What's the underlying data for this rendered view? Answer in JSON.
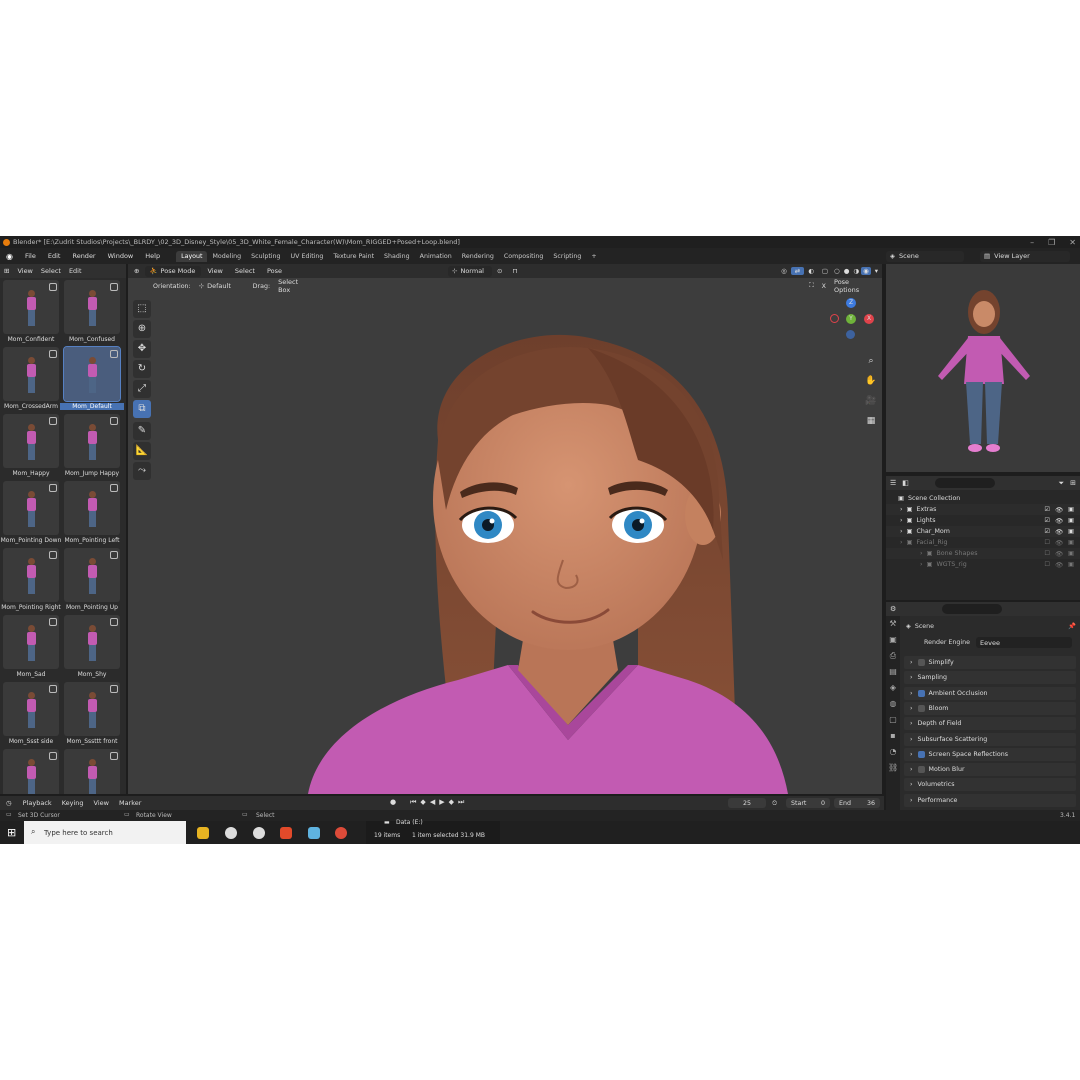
{
  "window": {
    "title": "Blender* [E:\\Zudrit Studios\\Projects\\_BLRDY_\\02_3D_Disney_Style\\05_3D_White_Female_Character(W)\\Mom_RIGGED+Posed+Loop.blend]"
  },
  "menu": [
    "File",
    "Edit",
    "Render",
    "Window",
    "Help"
  ],
  "workspace_tabs": [
    "Layout",
    "Modeling",
    "Sculpting",
    "UV Editing",
    "Texture Paint",
    "Shading",
    "Animation",
    "Rendering",
    "Compositing",
    "Scripting"
  ],
  "workspace_active": "Layout",
  "scene_field": "Scene",
  "view_layer_field": "View Layer",
  "asset_browser": {
    "menu": [
      "View",
      "Select",
      "Edit"
    ],
    "items": [
      {
        "label": "Mom_Confident"
      },
      {
        "label": "Mom_Confused"
      },
      {
        "label": "Mom_CrossedArm"
      },
      {
        "label": "Mom_Default",
        "active": true
      },
      {
        "label": "Mom_Happy"
      },
      {
        "label": "Mom_Jump Happy"
      },
      {
        "label": "Mom_Pointing Down"
      },
      {
        "label": "Mom_Pointing Left"
      },
      {
        "label": "Mom_Pointing Right"
      },
      {
        "label": "Mom_Pointing Up"
      },
      {
        "label": "Mom_Sad"
      },
      {
        "label": "Mom_Shy"
      },
      {
        "label": "Mom_Ssst side"
      },
      {
        "label": "Mom_Sssttt front"
      },
      {
        "label": ""
      },
      {
        "label": ""
      }
    ]
  },
  "viewport": {
    "mode": "Pose Mode",
    "menu": [
      "View",
      "Select",
      "Pose"
    ],
    "transform_orientation": "Normal",
    "orientation_label": "Orientation:",
    "orientation_value": "Default",
    "drag_label": "Drag:",
    "drag_value": "Select Box",
    "pose_options": "Pose Options",
    "gizmo_axes": {
      "x": "X",
      "y": "Y",
      "z": "Z"
    }
  },
  "outliner": {
    "root": "Scene Collection",
    "rows": [
      {
        "name": "Extras",
        "dim": false
      },
      {
        "name": "Lights",
        "dim": false
      },
      {
        "name": "Char_Mom",
        "dim": false
      },
      {
        "name": "Facial_Rig",
        "dim": true
      },
      {
        "name": "Bone Shapes",
        "dim": true
      },
      {
        "name": "WGTS_rig",
        "dim": true
      }
    ]
  },
  "properties": {
    "context": "Scene",
    "render_engine_label": "Render Engine",
    "render_engine_value": "Eevee",
    "panels": [
      {
        "label": "Simplify",
        "check": "off"
      },
      {
        "label": "Sampling",
        "check": "none"
      },
      {
        "label": "Ambient Occlusion",
        "check": "on"
      },
      {
        "label": "Bloom",
        "check": "off"
      },
      {
        "label": "Depth of Field",
        "check": "none"
      },
      {
        "label": "Subsurface Scattering",
        "check": "none"
      },
      {
        "label": "Screen Space Reflections",
        "check": "on"
      },
      {
        "label": "Motion Blur",
        "check": "off"
      },
      {
        "label": "Volumetrics",
        "check": "none"
      },
      {
        "label": "Performance",
        "check": "none"
      }
    ]
  },
  "timeline": {
    "menu": [
      "Playback",
      "Keying",
      "View",
      "Marker"
    ],
    "current_frame": "25",
    "start_label": "Start",
    "start_value": "0",
    "end_label": "End",
    "end_value": "36"
  },
  "statusbar": {
    "hints": [
      "Set 3D Cursor",
      "Rotate View",
      "Select"
    ],
    "version": "3.4.1"
  },
  "taskbar": {
    "search_placeholder": "Type here to search",
    "explorer_drive": "Data (E:)",
    "explorer_items": "19 items",
    "explorer_selected": "1 item selected  31.9 MB"
  },
  "colors": {
    "accent": "#4772b3",
    "shirt": "#c25bb2",
    "hair": "#7a4631",
    "skin": "#c98a68",
    "eye": "#2f88c4"
  }
}
